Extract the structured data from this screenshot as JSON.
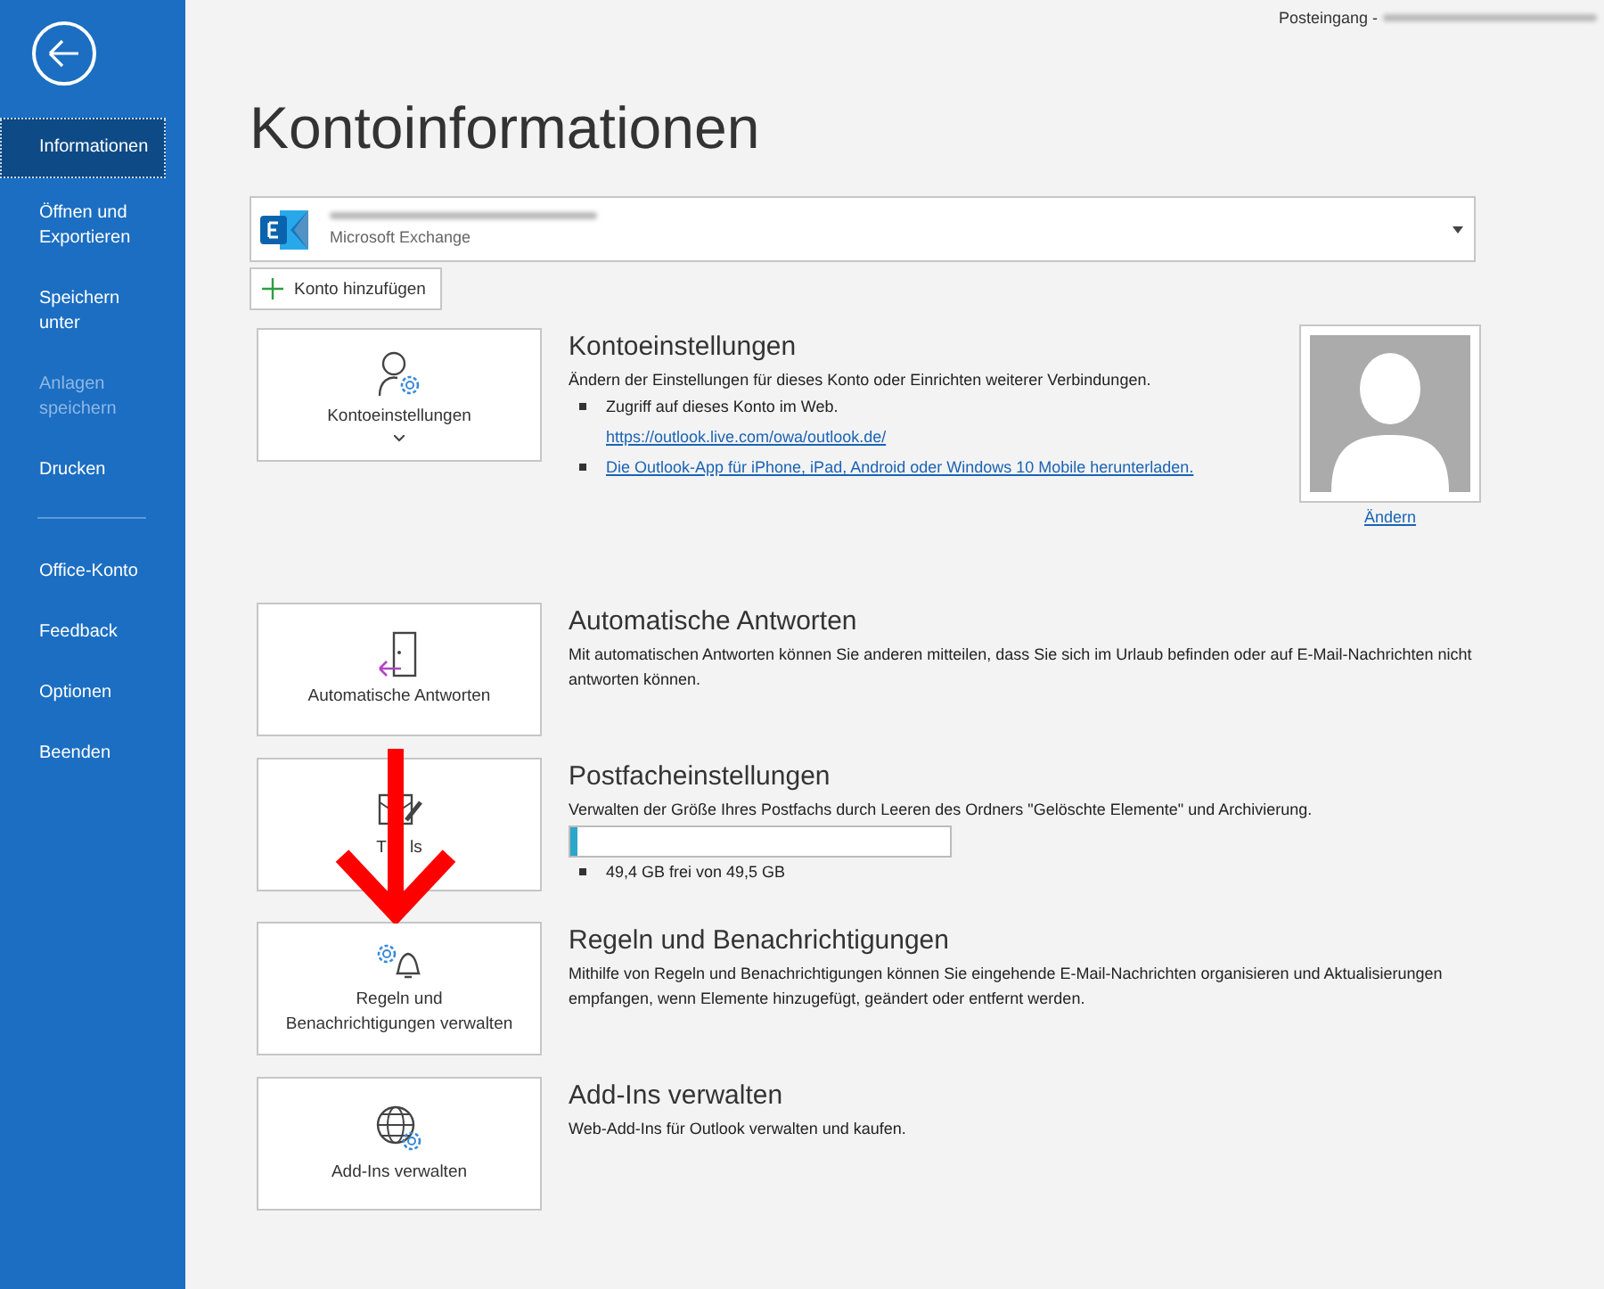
{
  "window": {
    "title": "Posteingang -"
  },
  "sidebar": {
    "items": [
      {
        "label": "Informationen",
        "selected": true,
        "disabled": false,
        "divider_after": false
      },
      {
        "label": "Öffnen und Exportieren",
        "selected": false,
        "disabled": false,
        "divider_after": false
      },
      {
        "label": "Speichern unter",
        "selected": false,
        "disabled": false,
        "divider_after": false
      },
      {
        "label": "Anlagen speichern",
        "selected": false,
        "disabled": true,
        "divider_after": false
      },
      {
        "label": "Drucken",
        "selected": false,
        "disabled": false,
        "divider_after": true
      },
      {
        "label": "Office-Konto",
        "selected": false,
        "disabled": false,
        "divider_after": false
      },
      {
        "label": "Feedback",
        "selected": false,
        "disabled": false,
        "divider_after": false
      },
      {
        "label": "Optionen",
        "selected": false,
        "disabled": false,
        "divider_after": false
      },
      {
        "label": "Beenden",
        "selected": false,
        "disabled": false,
        "divider_after": false
      }
    ]
  },
  "page_title": "Kontoinformationen",
  "account": {
    "type": "Microsoft Exchange"
  },
  "add_account": "Konto hinzufügen",
  "sections": [
    {
      "kind": "account",
      "tile": "Kontoeinstellungen",
      "title": "Kontoeinstellungen",
      "description": "Ändern der Einstellungen für dieses Konto oder Einrichten weiterer Verbindungen.",
      "bullets": [
        {
          "text": "Zugriff auf dieses Konto im Web.",
          "link": "https://outlook.live.com/owa/outlook.de/"
        },
        {
          "link": "Die Outlook-App für iPhone, iPad, Android oder Windows 10 Mobile herunterladen."
        }
      ],
      "photo_link": "Ändern"
    },
    {
      "kind": "auto_reply",
      "tile": "Automatische Antworten",
      "title": "Automatische Antworten",
      "description": "Mit automatischen Antworten können Sie anderen mitteilen, dass Sie sich im Urlaub befinden oder auf E-Mail-Nachrichten nicht antworten können."
    },
    {
      "kind": "mailbox",
      "tile": [
        "T",
        "ls"
      ],
      "title": "Postfacheinstellungen",
      "description": "Verwalten der Größe Ihres Postfachs durch Leeren des Ordners \"Gelöschte Elemente\" und Archivierung.",
      "storage": {
        "level": 0.02,
        "reading": "49,4 GB frei von 49,5 GB"
      }
    },
    {
      "kind": "rules",
      "tile": "Regeln und\nBenachrichtigungen verwalten",
      "title": "Regeln und Benachrichtigungen",
      "description": "Mithilfe von Regeln und Benachrichtigungen können Sie eingehende E-Mail-Nachrichten organisieren und Aktualisierungen empfangen, wenn Elemente hinzugefügt, geändert oder entfernt werden."
    },
    {
      "kind": "addins",
      "tile": "Add-Ins verwalten",
      "title": "Add-Ins verwalten",
      "description": "Web-Add-Ins für Outlook verwalten und kaufen."
    }
  ]
}
